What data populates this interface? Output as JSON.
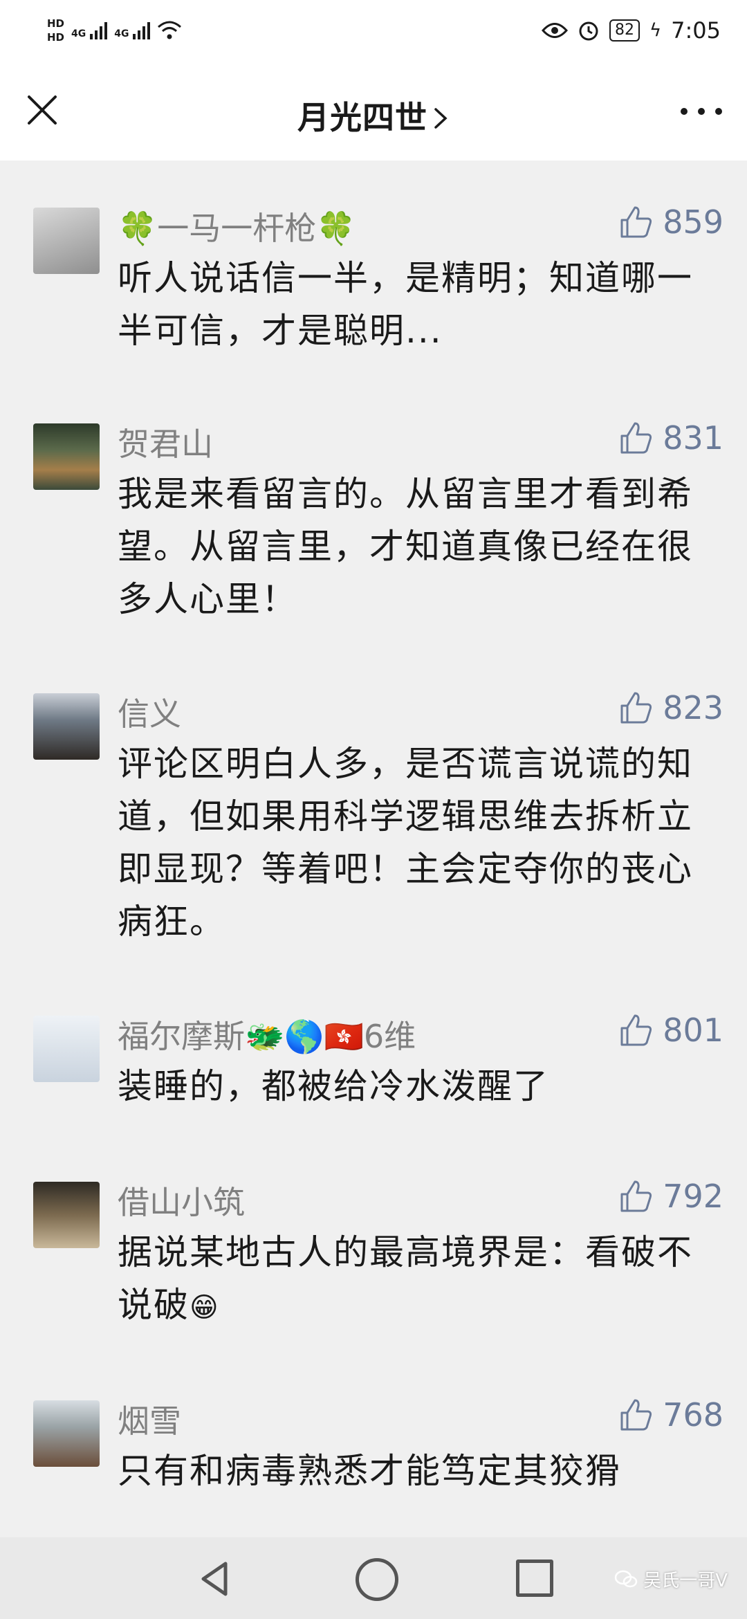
{
  "status_bar": {
    "hd_top": "HD",
    "hd_bottom": "HD",
    "network_1": "4G",
    "network_2": "4G",
    "battery": "82",
    "time": "7:05"
  },
  "header": {
    "title": "月光四世",
    "back_icon": "close-icon",
    "more_icon": "more-icon"
  },
  "comments": [
    {
      "name": "🍀一马一杆枪🍀",
      "likes": "859",
      "text": "听人说话信一半，是精明；知道哪一半可信，才是聪明..."
    },
    {
      "name": "贺君山",
      "likes": "831",
      "text": "我是来看留言的。从留言里才看到希望。从留言里，才知道真像已经在很多人心里！"
    },
    {
      "name": "信义",
      "likes": "823",
      "text": "评论区明白人多，是否谎言说谎的知道，但如果用科学逻辑思维去拆析立即显现？等着吧！主会定夺你的丧心病狂。"
    },
    {
      "name": "福尔摩斯🐲🌎🇭🇰6维",
      "likes": "801",
      "text": "装睡的，都被给冷水泼醒了"
    },
    {
      "name": "借山小筑",
      "likes": "792",
      "text": "据说某地古人的最高境界是：看破不说破",
      "emoji": "😁"
    },
    {
      "name": "烟雪",
      "likes": "768",
      "text": "只有和病毒熟悉才能笃定其狡猾"
    }
  ],
  "watermark": "吴氏一哥V"
}
